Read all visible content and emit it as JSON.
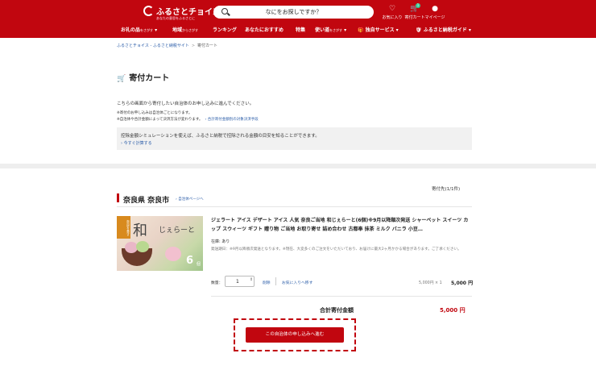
{
  "header": {
    "logo_name": "ふるさとチョイス",
    "logo_sub": "あなたの意思をふるさとに",
    "search_placeholder": "なにをお探しですか？",
    "favorites_label": "お気に入り",
    "cart_label": "寄付カート",
    "cart_count": "1",
    "mypage_label": "マイページ"
  },
  "nav": {
    "gift": "お礼の品",
    "gift_sub": "をさがす",
    "region": "地域",
    "region_sub": "からさがす",
    "ranking": "ランキング",
    "recommend": "あなたにおすすめ",
    "feature": "特集",
    "usage": "使い道",
    "usage_sub": "をさがす",
    "services": "独自サービス",
    "guide": "ふるさと納税ガイド"
  },
  "breadcrumb": {
    "home": "ふるさとチョイス - ふるさと納税サイト",
    "sep": ">",
    "current": "寄付カート"
  },
  "page": {
    "title": "寄付カート",
    "intro": "こちらの画面から寄付したい自治体のお申し込みに進んでください。",
    "note1": "※寄付のお申し込みは自治体ごとになります。",
    "note2": "※自治体や合計金額によって決済方法が変わります。",
    "note2_link": "› 合計寄付金額別の対象決済手段",
    "sim_text": "控除金額シミュレーションを使えば、ふるさと納税で控除される金額の目安を知ることができます。",
    "sim_link": "› 今すぐ計算する"
  },
  "cart": {
    "destinations": "寄付先(1/1件)",
    "municipality": "奈良県 奈良市",
    "municipality_link": "› 自治体ページへ",
    "item": {
      "name": "ジェラート アイス デザート アイス 人気 奈良ご当地 和じぇらーと(6個)※9月以降順次発送 シャーベット スイーツ カップ スウィーツ ギフト 贈り物 ご当地 お取り寄せ 詰め合わせ 古都奉 抹茶 ミルク バニラ 小豆…",
      "stock": "在庫: あり",
      "shipping": "発送期日：※9月以降順次発送となります。※現在、大変多くのご注文をいただいており、お届けに最大2ヶ月かかる場合があります。ご了承ください。",
      "quantity_label": "数量：",
      "quantity": "1",
      "delete": "削除",
      "favorite": "お気に入りへ移す",
      "unit_price": "5,000円 × 1",
      "subtotal": "5,000 円",
      "image_text": {
        "badge": "奈良を食す",
        "kanji": "和",
        "kana": "じぇらーと",
        "count": "6",
        "count_unit": "個"
      }
    },
    "total_label": "合計寄付金額",
    "total_value": "5,000 円",
    "apply_button": "この自治体の申し込みへ進む"
  },
  "colors": {
    "brand": "#c1060f",
    "link": "#2a5ca8"
  }
}
